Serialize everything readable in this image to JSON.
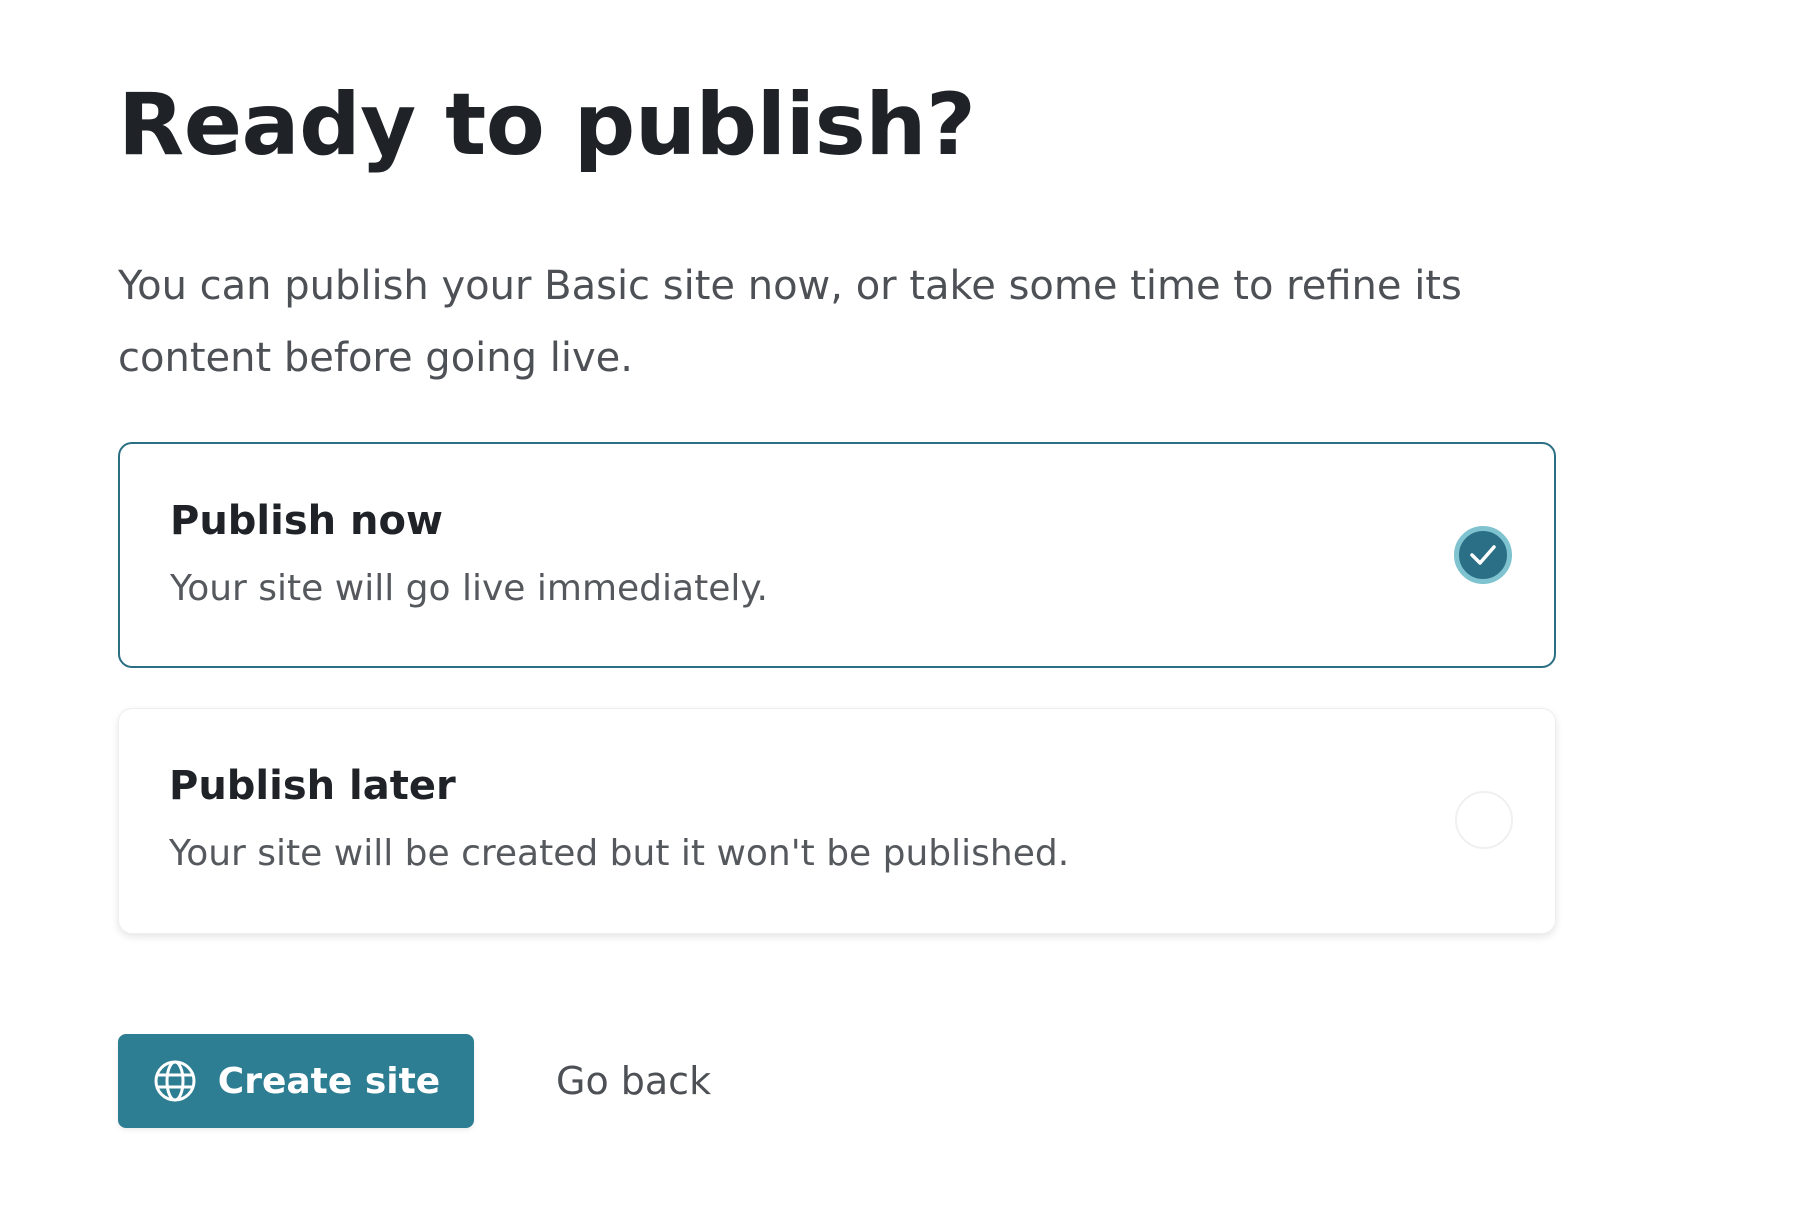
{
  "header": {
    "title": "Ready to publish?",
    "subtitle": "You can publish your Basic site now, or take some time to refine its content before going live."
  },
  "options": [
    {
      "title": "Publish now",
      "description": "Your site will go live immediately.",
      "selected": true
    },
    {
      "title": "Publish later",
      "description": "Your site will be created but it won't be published.",
      "selected": false
    }
  ],
  "actions": {
    "create_label": "Create site",
    "create_icon": "globe-icon",
    "back_label": "Go back"
  },
  "colors": {
    "accent": "#2d7e92",
    "selected_border": "#2b6f84",
    "radio_ring": "#7ec3cf"
  }
}
